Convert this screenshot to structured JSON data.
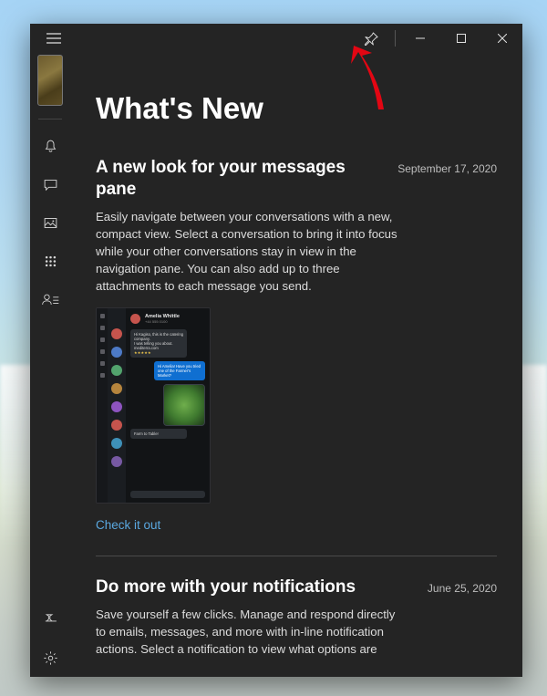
{
  "page": {
    "title": "What's New"
  },
  "articles": [
    {
      "title": "A new look for your messages pane",
      "date": "September 17, 2020",
      "body": "Easily navigate between your conversations with a new, compact view. Select a conversation to bring it into focus while your other conversations stay in view in the navigation pane. You can also add up to three attachments to each message you send.",
      "link": "Check it out",
      "preview_name": "Amelia Whittle"
    },
    {
      "title": "Do more with your notifications",
      "date": "June 25, 2020",
      "body": "Save yourself a few clicks. Manage and respond directly to emails, messages, and more with in-line notification actions. Select a notification to view what options are"
    }
  ],
  "icons": {
    "hamburger": "menu-icon",
    "pin": "pin-icon",
    "minimize": "minimize-icon",
    "maximize": "maximize-icon",
    "close": "close-icon",
    "notifications": "bell-icon",
    "messages": "chat-icon",
    "photos": "picture-icon",
    "apps": "dialpad-icon",
    "contacts": "contacts-icon",
    "pin_bottom": "unpin-icon",
    "settings": "gear-icon"
  },
  "sidebar": {
    "device_thumb": "phone-thumbnail"
  },
  "colors": {
    "link": "#5aa8e0",
    "bg": "#242424",
    "annotation": "#e30613"
  }
}
